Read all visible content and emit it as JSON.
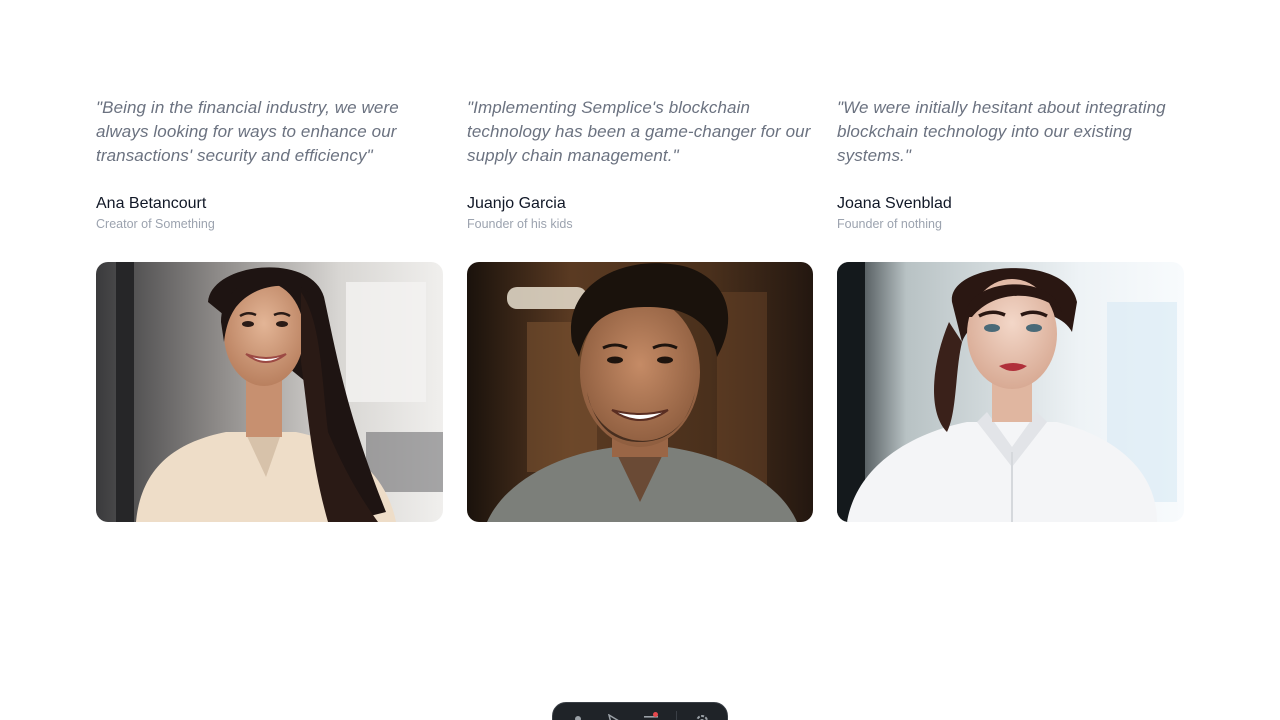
{
  "testimonials": [
    {
      "quote": "\"Being in the financial industry, we were always looking for ways to enhance our transactions' security and efficiency\"",
      "name": "Ana Betancourt",
      "role": "Creator of Something",
      "photo": "woman-smiling-photo"
    },
    {
      "quote": "\"Implementing Semplice's blockchain technology has been a game-changer for our supply chain management.\"",
      "name": "Juanjo Garcia",
      "role": "Founder of his kids",
      "photo": "man-smiling-photo"
    },
    {
      "quote": "\"We were initially hesitant about integrating blockchain technology into our existing systems.\"",
      "name": "Joana Svenblad",
      "role": "Founder of nothing",
      "photo": "woman-white-shirt-photo"
    }
  ],
  "toolbar": {
    "icons": [
      "user-icon",
      "cursor-icon",
      "menu-icon",
      "settings-icon"
    ],
    "notification_color": "#e5484d"
  },
  "colors": {
    "quote": "#6b7280",
    "name": "#111827",
    "role": "#9ca3af",
    "toolbar_bg": "#1f2328"
  }
}
